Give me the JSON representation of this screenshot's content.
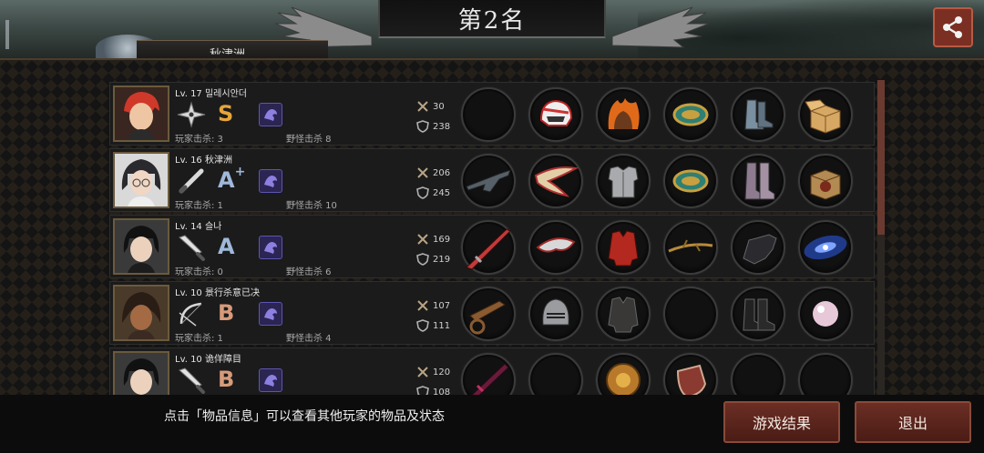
{
  "header": {
    "title": "第2名",
    "share_icon": "share-icon",
    "tab_label": "秋津洲"
  },
  "players": [
    {
      "name": "Lv. 17 밀레시안더",
      "grade": "S",
      "grade_plus": "",
      "grade_color": "#e6a53a",
      "weapon": "shuriken-icon",
      "kills_player": "玩家击杀: 3",
      "kills_monster": "野怪击杀 8",
      "attack": "30",
      "defense": "238",
      "items": [
        "empty",
        "helmet-icon",
        "flame-armor-icon",
        "bracer-icon",
        "boots-icon",
        "box-icon"
      ]
    },
    {
      "name": "Lv. 16 秋津洲",
      "grade": "A",
      "grade_plus": "+",
      "grade_color": "#9fb8da",
      "weapon": "baton-icon",
      "kills_player": "玩家击杀: 1",
      "kills_monster": "野怪击杀 10",
      "attack": "206",
      "defense": "245",
      "items": [
        "gun-icon",
        "wing-blade-icon",
        "plate-armor-icon",
        "bracer-icon",
        "long-boots-icon",
        "treasure-box-icon"
      ]
    },
    {
      "name": "Lv. 14 슬나",
      "grade": "A",
      "grade_plus": "",
      "grade_color": "#9fb8da",
      "weapon": "knife-icon",
      "kills_player": "玩家击杀: 0",
      "kills_monster": "野怪击杀 6",
      "attack": "169",
      "defense": "219",
      "items": [
        "red-sword-icon",
        "mask-icon",
        "red-coat-icon",
        "branch-icon",
        "claw-glove-icon",
        "galaxy-icon"
      ]
    },
    {
      "name": "Lv. 10 景行杀意已决",
      "grade": "B",
      "grade_plus": "",
      "grade_color": "#d79a7a",
      "weapon": "bow-icon",
      "kills_player": "玩家击杀: 1",
      "kills_monster": "野怪击杀 4",
      "attack": "107",
      "defense": "111",
      "items": [
        "cart-icon",
        "knight-helmet-icon",
        "jacket-icon",
        "empty",
        "leather-boots-icon",
        "pearl-icon"
      ]
    },
    {
      "name": "Lv. 10 诡佯障目",
      "grade": "B",
      "grade_plus": "",
      "grade_color": "#d79a7a",
      "weapon": "knife-icon",
      "kills_player": "",
      "kills_monster": "",
      "attack": "120",
      "defense": "108",
      "items": [
        "dark-blade-icon",
        "empty",
        "gold-armor-icon",
        "shield-icon",
        "empty",
        "empty"
      ]
    }
  ],
  "footer": {
    "hint": "点击「物品信息」可以查看其他玩家的物品及状态",
    "result_button": "游戏结果",
    "exit_button": "退出"
  }
}
